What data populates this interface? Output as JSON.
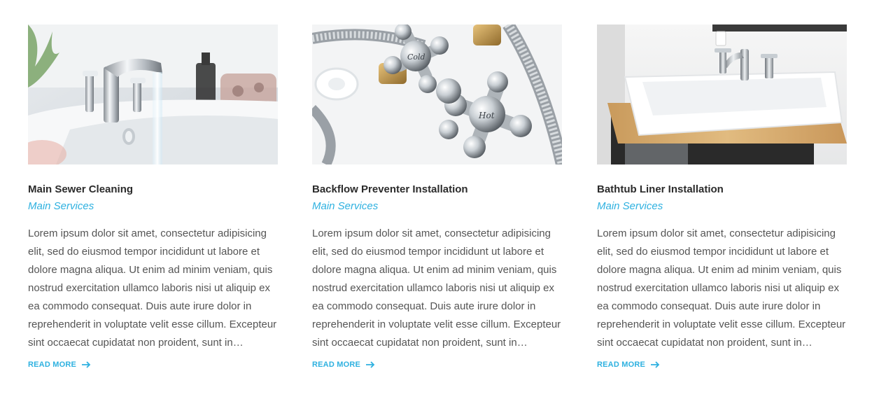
{
  "cards": [
    {
      "title": "Main Sewer Cleaning",
      "category": "Main Services",
      "excerpt": "Lorem ipsum dolor sit amet, consectetur adipisicing elit, sed do eiusmod tempor incididunt ut labore et dolore magna aliqua. Ut enim ad minim veniam, quis nostrud exercitation ullamco laboris nisi ut aliquip ex ea commodo consequat. Duis aute irure dolor in reprehenderit in voluptate velit esse cillum.  Excepteur sint occaecat cupidatat non proident, sunt in…",
      "read_more": "READ MORE",
      "image": "faucet-sink-photo"
    },
    {
      "title": "Backflow Preventer Installation",
      "category": "Main Services",
      "excerpt": "Lorem ipsum dolor sit amet, consectetur adipisicing elit, sed do eiusmod tempor incididunt ut labore et dolore magna aliqua. Ut enim ad minim veniam, quis nostrud exercitation ullamco laboris nisi ut aliquip ex ea commodo consequat. Duis aute irure dolor in reprehenderit in voluptate velit esse cillum.  Excepteur sint occaecat cupidatat non proident, sunt in…",
      "read_more": "READ MORE",
      "image": "valve-handles-photo",
      "handle_labels": [
        "Cold",
        "Hot"
      ]
    },
    {
      "title": "Bathtub Liner Installation",
      "category": "Main Services",
      "excerpt": "Lorem ipsum dolor sit amet, consectetur adipisicing elit, sed do eiusmod tempor incididunt ut labore et dolore magna aliqua. Ut enim ad minim veniam, quis nostrud exercitation ullamco laboris nisi ut aliquip ex ea commodo consequat. Duis aute irure dolor in reprehenderit in voluptate velit esse cillum.  Excepteur sint occaecat cupidatat non proident, sunt in…",
      "read_more": "READ MORE",
      "image": "vessel-sink-photo"
    }
  ],
  "colors": {
    "accent": "#2eb1e0",
    "title": "#2b2b2b",
    "body_text": "#555555"
  },
  "icons": {
    "read_more": "arrow-right-icon"
  }
}
